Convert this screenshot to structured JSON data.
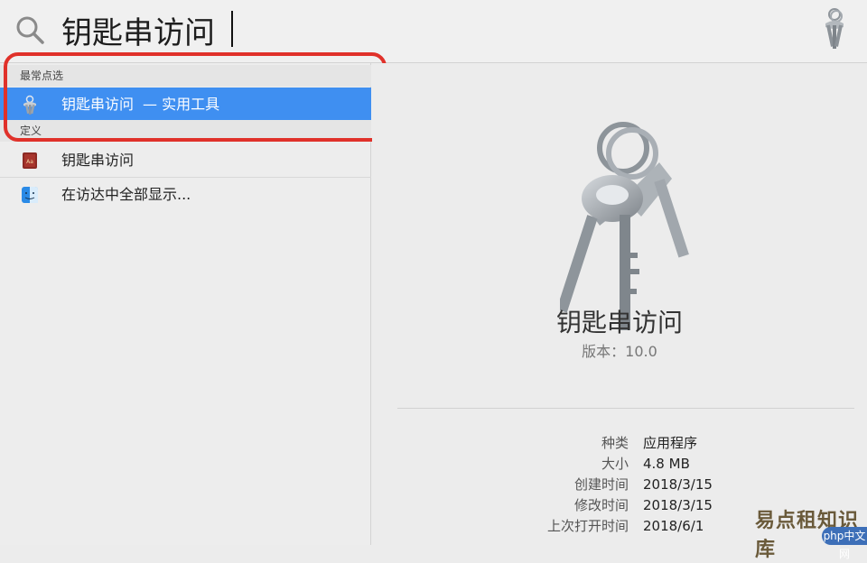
{
  "search": {
    "query": "钥匙串访问",
    "icon": "search-icon",
    "app_icon": "keychain-access-icon"
  },
  "results": {
    "sections": [
      {
        "header": "最常点选",
        "items": [
          {
            "label": "钥匙串访问",
            "sublabel": "— 实用工具",
            "icon": "keychain-access-icon",
            "selected": true
          }
        ]
      },
      {
        "header": "定义",
        "items": [
          {
            "label": "钥匙串访问",
            "sublabel": "",
            "icon": "dictionary-icon",
            "selected": false
          },
          {
            "label": "在访达中全部显示...",
            "sublabel": "",
            "icon": "finder-icon",
            "selected": false
          }
        ]
      }
    ]
  },
  "preview": {
    "title": "钥匙串访问",
    "version": "版本：10.0",
    "icon": "keychain-access-icon",
    "meta": [
      {
        "key": "种类",
        "value": "应用程序"
      },
      {
        "key": "大小",
        "value": "4.8 MB"
      },
      {
        "key": "创建时间",
        "value": "2018/3/15"
      },
      {
        "key": "修改时间",
        "value": "2018/3/15"
      },
      {
        "key": "上次打开时间",
        "value": "2018/6/1"
      }
    ]
  },
  "watermark": {
    "text": "易点租知识库",
    "badge_site": "php",
    "badge_text": "中文网"
  },
  "colors": {
    "selection": "#3f8ff1",
    "highlight_ring": "#e0312a",
    "background": "#ececec"
  }
}
